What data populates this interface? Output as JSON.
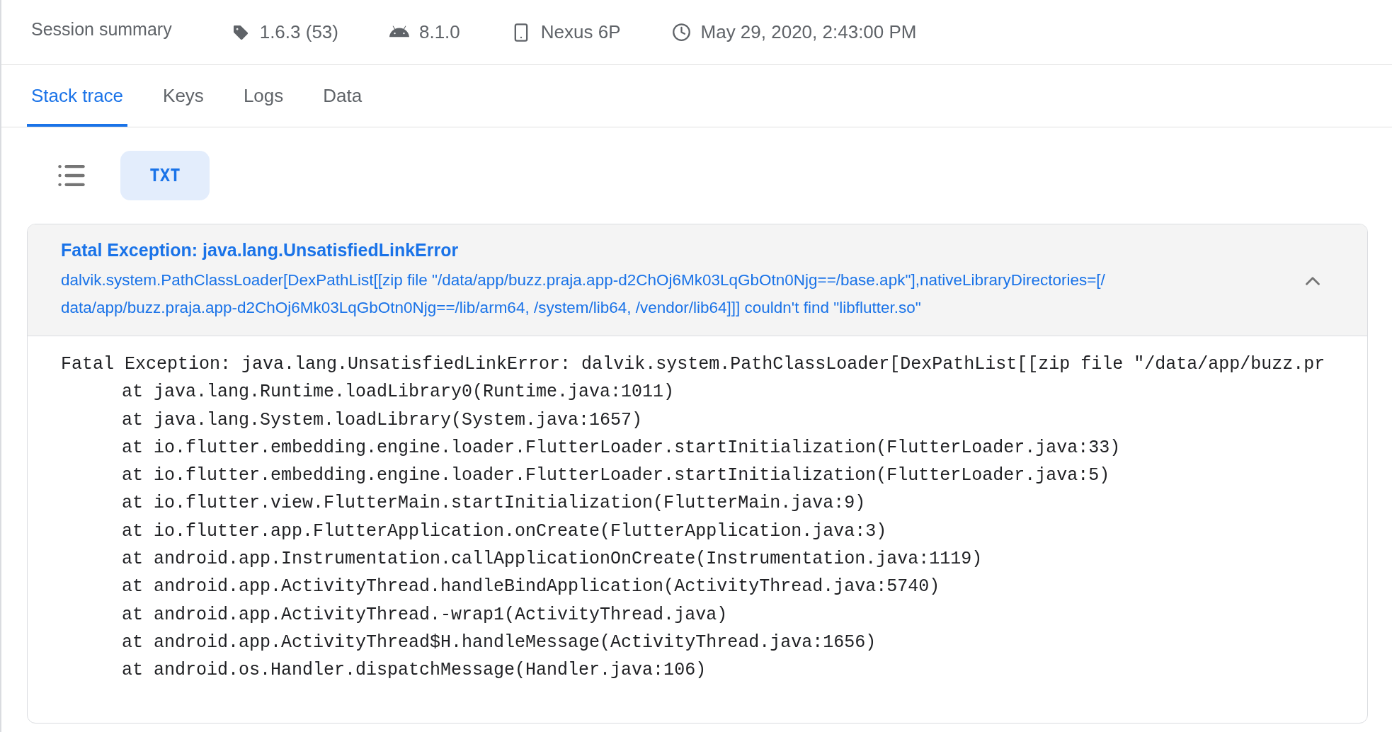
{
  "header": {
    "title": "Session summary",
    "items": [
      {
        "kind": "version",
        "text": "1.6.3 (53)"
      },
      {
        "kind": "os",
        "text": "8.1.0"
      },
      {
        "kind": "device",
        "text": "Nexus 6P"
      },
      {
        "kind": "time",
        "text": "May 29, 2020, 2:43:00 PM"
      }
    ]
  },
  "tabs": [
    {
      "label": "Stack trace",
      "selected": true
    },
    {
      "label": "Keys",
      "selected": false
    },
    {
      "label": "Logs",
      "selected": false
    },
    {
      "label": "Data",
      "selected": false
    }
  ],
  "view_toggle": [
    {
      "kind": "list",
      "selected": false
    },
    {
      "kind": "text",
      "label": "TXT",
      "selected": true
    }
  ],
  "exception": {
    "title": "Fatal Exception: java.lang.UnsatisfiedLinkError",
    "expanded": true,
    "message_lines": [
      "dalvik.system.PathClassLoader[DexPathList[[zip file \"/data/app/buzz.praja.app-d2ChOj6Mk03LqGbOtn0Njg==/base.apk\"],nativeLibraryDirectories=[/",
      "data/app/buzz.praja.app-d2ChOj6Mk03LqGbOtn0Njg==/lib/arm64, /system/lib64, /vendor/lib64]]] couldn't find \"libflutter.so\""
    ]
  },
  "trace": {
    "head": "Fatal Exception: java.lang.UnsatisfiedLinkError: dalvik.system.PathClassLoader[DexPathList[[zip file \"/data/app/buzz.pr",
    "frames": [
      "at java.lang.Runtime.loadLibrary0(Runtime.java:1011)",
      "at java.lang.System.loadLibrary(System.java:1657)",
      "at io.flutter.embedding.engine.loader.FlutterLoader.startInitialization(FlutterLoader.java:33)",
      "at io.flutter.embedding.engine.loader.FlutterLoader.startInitialization(FlutterLoader.java:5)",
      "at io.flutter.view.FlutterMain.startInitialization(FlutterMain.java:9)",
      "at io.flutter.app.FlutterApplication.onCreate(FlutterApplication.java:3)",
      "at android.app.Instrumentation.callApplicationOnCreate(Instrumentation.java:1119)",
      "at android.app.ActivityThread.handleBindApplication(ActivityThread.java:5740)",
      "at android.app.ActivityThread.-wrap1(ActivityThread.java)",
      "at android.app.ActivityThread$H.handleMessage(ActivityThread.java:1656)",
      "at android.os.Handler.dispatchMessage(Handler.java:106)"
    ]
  }
}
